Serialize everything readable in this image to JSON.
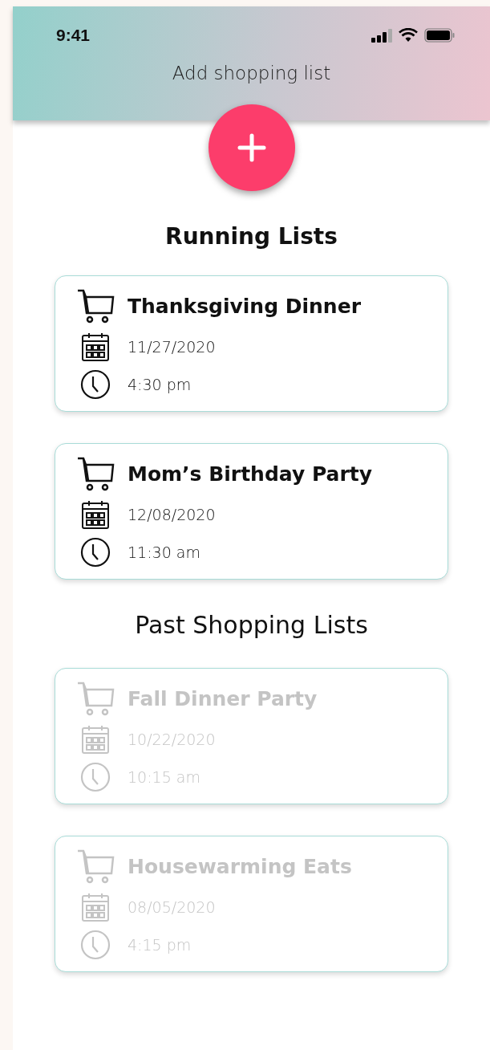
{
  "status_bar": {
    "time": "9:41"
  },
  "header": {
    "title": "Add shopping list"
  },
  "sections": [
    {
      "kind": "running",
      "title": "Running Lists",
      "lists": [
        {
          "name": "Thanksgiving Dinner",
          "date": "11/27/2020",
          "time": "4:30 pm",
          "disabled": false
        },
        {
          "name": "Mom’s Birthday Party",
          "date": "12/08/2020",
          "time": "11:30 am",
          "disabled": false
        }
      ]
    },
    {
      "kind": "past",
      "title": "Past Shopping Lists",
      "lists": [
        {
          "name": "Fall Dinner Party",
          "date": "10/22/2020",
          "time": "10:15 am",
          "disabled": true
        },
        {
          "name": "Housewarming Eats",
          "date": "08/05/2020",
          "time": "4:15 pm",
          "disabled": true
        }
      ]
    }
  ]
}
